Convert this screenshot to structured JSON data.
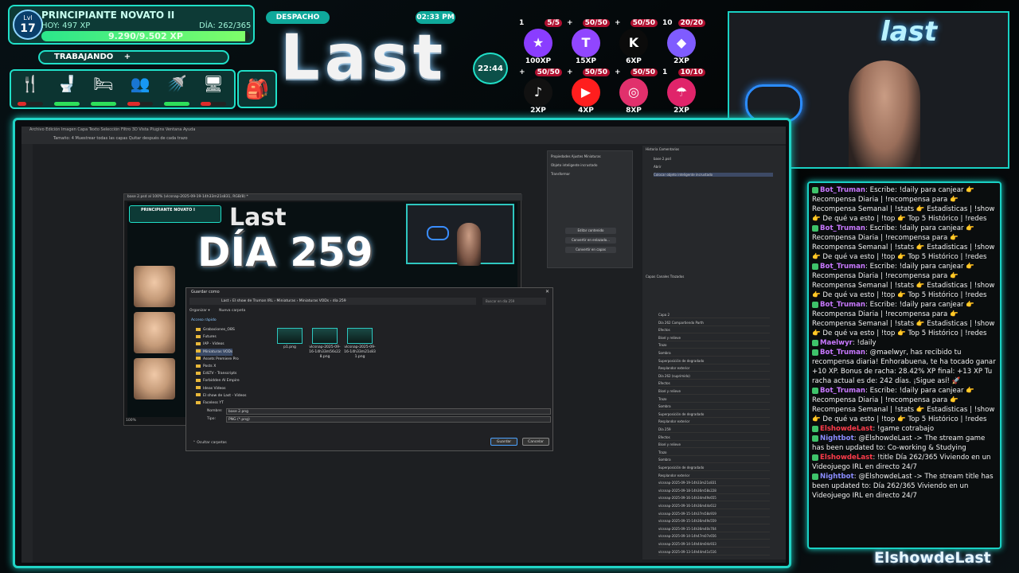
{
  "hud": {
    "level_label": "Lvl",
    "level": "17",
    "rank": "PRINCIPIANTE NOVATO II",
    "today": "HOY: 497 XP",
    "day": "DÍA: 262/365",
    "xp": "9.290/9.502 XP",
    "xp_fraction": 0.978,
    "status": "TRABAJANDO",
    "status_plus": "+",
    "needs": [
      {
        "icon": "fork-knife-icon",
        "glyph": "🍴",
        "level": 0.35,
        "color": "#e02b2b"
      },
      {
        "icon": "toilet-icon",
        "glyph": "🚽",
        "level": 1.0,
        "color": "#2ee05a"
      },
      {
        "icon": "bed-icon",
        "glyph": "🛏",
        "level": 1.0,
        "color": "#2ee05a"
      },
      {
        "icon": "social-icon",
        "glyph": "👥",
        "level": 0.5,
        "color": "#e02b2b"
      },
      {
        "icon": "shower-icon",
        "glyph": "🚿",
        "level": 1.0,
        "color": "#2ee05a"
      },
      {
        "icon": "computer-icon",
        "glyph": "🖥",
        "level": 0.4,
        "color": "#e02b2b"
      }
    ],
    "backpack_glyph": "🎒"
  },
  "header": {
    "despacho": "DESPACHO",
    "clock": "02:33 PM",
    "logo": "Last",
    "timer": "22:44"
  },
  "goals": [
    {
      "num": "1",
      "count": "5/5",
      "glyph": "★",
      "xp": "100XP",
      "bg": "#8a3dff",
      "icon": "star-icon"
    },
    {
      "num": "+",
      "count": "50/50",
      "glyph": "T",
      "xp": "15XP",
      "bg": "#9146ff",
      "icon": "twitch-icon"
    },
    {
      "num": "+",
      "count": "50/50",
      "glyph": "K",
      "xp": "6XP",
      "bg": "#0b0b0b",
      "icon": "kick-icon"
    },
    {
      "num": "10",
      "count": "20/20",
      "glyph": "◆",
      "xp": "2XP",
      "bg": "#7f5cff",
      "icon": "gem-icon"
    },
    {
      "num": "+",
      "count": "50/50",
      "glyph": "♪",
      "xp": "2XP",
      "bg": "#111111",
      "icon": "tiktok-icon"
    },
    {
      "num": "+",
      "count": "50/50",
      "glyph": "▶",
      "xp": "4XP",
      "bg": "#ff1e1e",
      "icon": "youtube-icon"
    },
    {
      "num": "+",
      "count": "50/50",
      "glyph": "◎",
      "xp": "8XP",
      "bg": "#e1306c",
      "icon": "instagram-icon"
    },
    {
      "num": "1",
      "count": "10/10",
      "glyph": "☂",
      "xp": "2XP",
      "bg": "#e0246a",
      "icon": "drop-icon"
    }
  ],
  "camera": {
    "sign": "last"
  },
  "photoshop": {
    "menu": "Archivo  Edición  Imagen  Capa  Texto  Selección  Filtro  3D  Vista  Plugins  Ventana  Ayuda",
    "options": "Tamaño: 4     Muestrear todas las capas     Quitar después de cada trazo",
    "window_title": "base 2.psd al 100% (vlcsnap-2025-09-19-14h33m21s831, RGB/8) *",
    "zoom": "100%",
    "thumb_day": "DÍA 259",
    "thumb_rank": "PRINCIPIANTE NOVATO I",
    "thumb_logo": "Last",
    "props_title": "Propiedades   Ajustes   Miniaturas",
    "props_object": "Objeto inteligente incrustado",
    "props_transform": "Transformar",
    "props_buttons": [
      "Editar contenido",
      "Convertir en enlazado...",
      "Convertir en capas"
    ],
    "history_title": "Historia   Comentarios",
    "history_items": [
      "base 2.psd",
      "Abrir",
      "Colocar objeto inteligente incrustado"
    ],
    "layers_tabs": "Capas   Canales   Trazados",
    "layers": [
      "Capa 2",
      "Día 262 Compartiendo Parth",
      "Efectos",
      "Bisel y relieve",
      "Trazo",
      "Sombra",
      "Superposición de degradado",
      "Resplandor exterior",
      "Día 262 (suprimido)",
      "Efectos",
      "Bisel y relieve",
      "Trazo",
      "Sombra",
      "Superposición de degradado",
      "Resplandor exterior",
      "Día 259",
      "Efectos",
      "Bisel y relieve",
      "Trazo",
      "Sombra",
      "Superposición de degradado",
      "Resplandor exterior",
      "vlcsnap-2025-09-19-14h33m21s831",
      "vlcsnap-2025-09-18-14h36m58s228",
      "vlcsnap-2025-09-16-14h34m49s655",
      "vlcsnap-2025-09-16-14h36m44s612",
      "vlcsnap-2025-09-15-14h37m58s919",
      "vlcsnap-2025-09-15-14h36m49s559",
      "vlcsnap-2025-09-15-14h36m40s704",
      "vlcsnap-2025-09-14-14h47m07s656",
      "vlcsnap-2025-09-14-14h44m04s933",
      "vlcsnap-2025-09-13-14h44m41s516"
    ]
  },
  "dialog": {
    "title": "Guardar como",
    "path": "Last  ›  El show de Truman IRL  ›  Miniaturas  ›  Miniaturas VODs  ›  día 259",
    "search": "Buscar en día 259",
    "organize": "Organizar ▾",
    "new_folder": "Nueva carpeta",
    "quick_access": "Acceso rápido",
    "folders": [
      "Grabaciones_OBS",
      "Futures",
      "IAP - Videos",
      "Miniaturas VODs",
      "Assets Premiere Pro",
      "Posts X",
      "EdLTV - Transcripts",
      "Forbidden AI Empire",
      "Ideas Videos",
      "El show de Last - Videos",
      "Faceless YT"
    ],
    "files": [
      "p1.png",
      "vlcsnap-2025-09-16-14h33m56s22 8.png",
      "vlcsnap-2025-09-16-14h33m21s83 1.png"
    ],
    "name_label": "Nombre:",
    "name_value": "base 2.png",
    "type_label": "Tipo:",
    "type_value": "PNG (*.png)",
    "hide_folders": "⌃ Ocultar carpetas",
    "save": "Guardar",
    "cancel": "Cancelar"
  },
  "chat": [
    {
      "user": "Bot_Truman",
      "text": ": Escribe: !daily para canjear 👉 Recompensa Diaria | !recompensa para 👉 Recompensa Semanal | !stats 👉 Estadisticas | !show 👉 De qué va esto | !top 👉 Top 5 Histórico | !redes",
      "kind": ""
    },
    {
      "user": "Bot_Truman",
      "text": ": Escribe: !daily para canjear 👉 Recompensa Diaria | !recompensa para 👉 Recompensa Semanal | !stats 👉 Estadisticas | !show 👉 De qué va esto | !top 👉 Top 5 Histórico | !redes",
      "kind": ""
    },
    {
      "user": "Bot_Truman",
      "text": ": Escribe: !daily para canjear 👉 Recompensa Diaria | !recompensa para 👉 Recompensa Semanal | !stats 👉 Estadisticas | !show 👉 De qué va esto | !top 👉 Top 5 Histórico | !redes",
      "kind": ""
    },
    {
      "user": "Bot_Truman",
      "text": ": Escribe: !daily para canjear 👉 Recompensa Diaria | !recompensa para 👉 Recompensa Semanal | !stats 👉 Estadisticas | !show 👉 De qué va esto | !top 👉 Top 5 Histórico | !redes",
      "kind": ""
    },
    {
      "user": "Maelwyr",
      "text": ": !daily",
      "kind": ""
    },
    {
      "user": "Bot_Truman",
      "text": ": @maelwyr, has recibido tu recompensa diaria! Enhorabuena, te ha tocado ganar +10 XP. Bonus de racha: 28.42% XP final: +13 XP Tu racha actual es de: 242 días. ¡Sigue así! 🚀",
      "kind": ""
    },
    {
      "user": "Bot_Truman",
      "text": ": Escribe: !daily para canjear 👉 Recompensa Diaria | !recompensa para 👉 Recompensa Semanal | !stats 👉 Estadisticas | !show 👉 De qué va esto | !top 👉 Top 5 Histórico | !redes",
      "kind": ""
    },
    {
      "user": "ElshowdeLast",
      "text": ": !game cotrabajo",
      "kind": "es"
    },
    {
      "user": "Nightbot",
      "text": ": @ElshowdeLast -> The stream game has been updated to: Co-working & Studying",
      "kind": "nb"
    },
    {
      "user": "ElshowdeLast",
      "text": ": !title Día 262/365 Viviendo en un Videojuego IRL en directo 24/7",
      "kind": "es"
    },
    {
      "user": "Nightbot",
      "text": ": @ElshowdeLast -> The stream title has been updated to: Día 262/365 Viviendo en un Videojuego IRL en directo 24/7",
      "kind": "nb"
    }
  ],
  "brand": "ElshowdeLast"
}
